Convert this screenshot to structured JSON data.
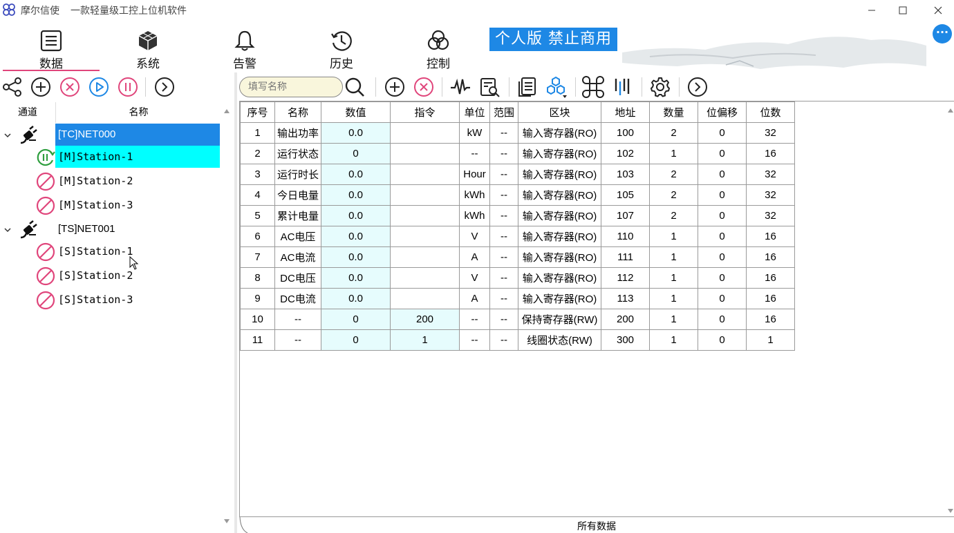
{
  "window": {
    "app_name": "摩尔信使",
    "slogan": "一款轻量级工控上位机软件"
  },
  "nav": {
    "items": [
      {
        "label": "数据",
        "icon": "list-icon"
      },
      {
        "label": "系统",
        "icon": "cube-icon"
      },
      {
        "label": "告警",
        "icon": "bell-icon"
      },
      {
        "label": "历史",
        "icon": "clock-icon"
      },
      {
        "label": "控制",
        "icon": "triquetra-icon"
      }
    ],
    "active": "数据"
  },
  "banner": "个人版  禁止商用",
  "more_button": "···",
  "search": {
    "placeholder": "填写名称"
  },
  "tree": {
    "headers": {
      "channel": "通道",
      "name": "名称"
    },
    "nodes": [
      {
        "label": "[TC]NET000",
        "type": "channel",
        "selected": true
      },
      {
        "label": "[M]Station-1",
        "type": "device",
        "status": "running",
        "highlight": true
      },
      {
        "label": "[M]Station-2",
        "type": "device",
        "status": "disabled"
      },
      {
        "label": "[M]Station-3",
        "type": "device",
        "status": "disabled"
      },
      {
        "label": "[TS]NET001",
        "type": "channel"
      },
      {
        "label": "[S]Station-1",
        "type": "device",
        "status": "disabled"
      },
      {
        "label": "[S]Station-2",
        "type": "device",
        "status": "disabled"
      },
      {
        "label": "[S]Station-3",
        "type": "device",
        "status": "disabled"
      }
    ]
  },
  "table": {
    "headers": [
      "序号",
      "名称",
      "数值",
      "指令",
      "单位",
      "范围",
      "区块",
      "地址",
      "数量",
      "位偏移",
      "位数"
    ],
    "rows": [
      [
        "1",
        "输出功率",
        "0.0",
        "",
        "kW",
        "--",
        "输入寄存器(RO)",
        "100",
        "2",
        "0",
        "32"
      ],
      [
        "2",
        "运行状态",
        "0",
        "",
        "--",
        "--",
        "输入寄存器(RO)",
        "102",
        "1",
        "0",
        "16"
      ],
      [
        "3",
        "运行时长",
        "0.0",
        "",
        "Hour",
        "--",
        "输入寄存器(RO)",
        "103",
        "2",
        "0",
        "32"
      ],
      [
        "4",
        "今日电量",
        "0.0",
        "",
        "kWh",
        "--",
        "输入寄存器(RO)",
        "105",
        "2",
        "0",
        "32"
      ],
      [
        "5",
        "累计电量",
        "0.0",
        "",
        "kWh",
        "--",
        "输入寄存器(RO)",
        "107",
        "2",
        "0",
        "32"
      ],
      [
        "6",
        "AC电压",
        "0.0",
        "",
        "V",
        "--",
        "输入寄存器(RO)",
        "110",
        "1",
        "0",
        "16"
      ],
      [
        "7",
        "AC电流",
        "0.0",
        "",
        "A",
        "--",
        "输入寄存器(RO)",
        "111",
        "1",
        "0",
        "16"
      ],
      [
        "8",
        "DC电压",
        "0.0",
        "",
        "V",
        "--",
        "输入寄存器(RO)",
        "112",
        "1",
        "0",
        "16"
      ],
      [
        "9",
        "DC电流",
        "0.0",
        "",
        "A",
        "--",
        "输入寄存器(RO)",
        "113",
        "1",
        "0",
        "16"
      ],
      [
        "10",
        "--",
        "0",
        "200",
        "--",
        "--",
        "保持寄存器(RW)",
        "200",
        "1",
        "0",
        "16"
      ],
      [
        "11",
        "--",
        "0",
        "1",
        "--",
        "--",
        "线圈状态(RW)",
        "300",
        "1",
        "0",
        "1"
      ]
    ]
  },
  "bottom_tab": "所有数据",
  "colors": {
    "accent_pink": "#e0457b",
    "accent_blue": "#1e88e5",
    "selected_row": "#1e88e5",
    "highlight_row": "#00ffff",
    "value_cell": "#e6fcfd",
    "running_green": "#2e9e3e"
  }
}
